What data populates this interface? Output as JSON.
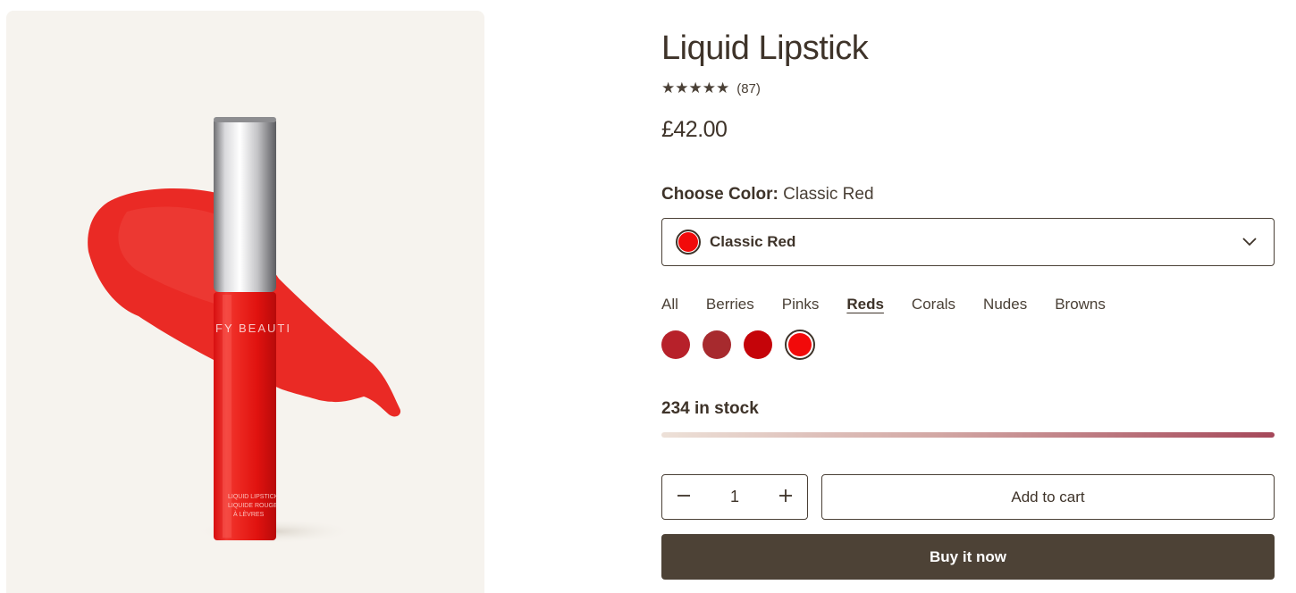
{
  "product": {
    "title": "Liquid Lipstick",
    "stars": "★★★★★",
    "review_count": "(87)",
    "rating": 5,
    "price": "£42.00"
  },
  "media": {
    "brand_text": "FY BEAUTI",
    "tube_text_1": "LIQUID LIPSTICK",
    "tube_text_2": "LIQUIDE ROUGE",
    "tube_text_3": "À LÈVRES"
  },
  "color_picker": {
    "label": "Choose Color:",
    "selected_value": "Classic Red",
    "selected_color": "#f20a0a",
    "tabs": [
      {
        "label": "All",
        "active": false
      },
      {
        "label": "Berries",
        "active": false
      },
      {
        "label": "Pinks",
        "active": false
      },
      {
        "label": "Reds",
        "active": true
      },
      {
        "label": "Corals",
        "active": false
      },
      {
        "label": "Nudes",
        "active": false
      },
      {
        "label": "Browns",
        "active": false
      }
    ],
    "swatches": [
      {
        "color": "#b7212a",
        "selected": false
      },
      {
        "color": "#a72a2e",
        "selected": false
      },
      {
        "color": "#c50409",
        "selected": false
      },
      {
        "color": "#f20a0a",
        "selected": true
      }
    ]
  },
  "inventory": {
    "stock_text": "234 in stock",
    "level": 1.0
  },
  "purchase": {
    "quantity": "1",
    "minus_icon": "minus-icon",
    "plus_icon": "plus-icon",
    "add_to_cart": "Add to cart",
    "buy_now": "Buy it now"
  },
  "colors": {
    "text": "#3e3329",
    "buy_button_bg": "#4d4236",
    "media_bg": "#f6f3ee"
  }
}
